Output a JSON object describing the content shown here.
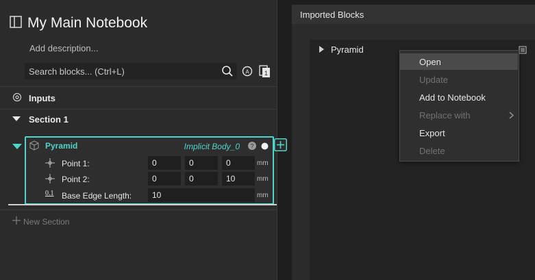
{
  "notebook": {
    "title": "My Main Notebook",
    "description_placeholder": "Add description...",
    "search_placeholder": "Search blocks... (Ctrl+L)",
    "inputs_label": "Inputs",
    "section_label": "Section 1",
    "new_section_label": "New Section"
  },
  "block": {
    "name": "Pyramid",
    "output": "Implicit Body_0",
    "params": [
      {
        "label": "Point 1:",
        "values": [
          "0",
          "0",
          "0"
        ],
        "unit": "mm"
      },
      {
        "label": "Point 2:",
        "values": [
          "0",
          "0",
          "10"
        ],
        "unit": "mm"
      },
      {
        "label": "Base Edge Length:",
        "values": [
          "10"
        ],
        "unit": "mm"
      }
    ],
    "scalar_icon_text": "0.1"
  },
  "imported": {
    "header": "Imported Blocks",
    "item": "Pyramid"
  },
  "context_menu": {
    "items": [
      {
        "label": "Open",
        "state": "highlighted"
      },
      {
        "label": "Update",
        "state": "disabled"
      },
      {
        "label": "Add to Notebook",
        "state": "enabled"
      },
      {
        "label": "Replace with",
        "state": "disabled"
      },
      {
        "label": "Export",
        "state": "enabled"
      },
      {
        "label": "Delete",
        "state": "disabled"
      }
    ]
  },
  "colors": {
    "accent": "#4fd6cc",
    "panel": "#2b2b2b",
    "background": "#1e1e1e"
  }
}
